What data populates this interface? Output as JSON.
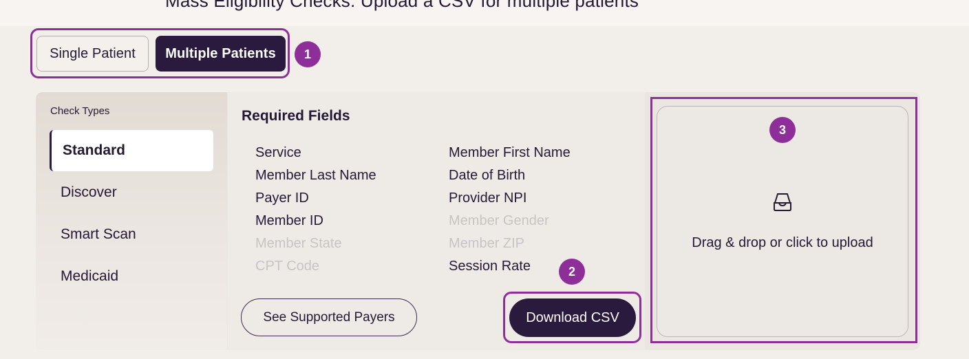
{
  "header": {
    "cut_text": "Mass Eligibility Checks: Upload a CSV for multiple patients"
  },
  "mode_toggle": {
    "single_label": "Single Patient",
    "multiple_label": "Multiple Patients",
    "selected": "Multiple Patients"
  },
  "badges": [
    "1",
    "2",
    "3"
  ],
  "sidebar": {
    "title": "Check Types",
    "items": [
      {
        "label": "Standard",
        "active": true
      },
      {
        "label": "Discover",
        "active": false
      },
      {
        "label": "Smart Scan",
        "active": false
      },
      {
        "label": "Medicaid",
        "active": false
      }
    ]
  },
  "required_fields": {
    "title": "Required Fields",
    "fields": [
      {
        "label": "Service",
        "required": true
      },
      {
        "label": "Member First Name",
        "required": true
      },
      {
        "label": "Member Last Name",
        "required": true
      },
      {
        "label": "Date of Birth",
        "required": true
      },
      {
        "label": "Payer ID",
        "required": true
      },
      {
        "label": "Provider NPI",
        "required": true
      },
      {
        "label": "Member ID",
        "required": true
      },
      {
        "label": "Member Gender",
        "required": false
      },
      {
        "label": "Member State",
        "required": false
      },
      {
        "label": "Member ZIP",
        "required": false
      },
      {
        "label": "CPT Code",
        "required": false
      },
      {
        "label": "Session Rate",
        "required": true
      }
    ]
  },
  "actions": {
    "payers_label": "See Supported Payers",
    "download_label": "Download CSV"
  },
  "upload": {
    "icon": "inbox-tray-icon",
    "label": "Drag & drop or click to upload"
  },
  "colors": {
    "accent": "#8e2f99",
    "dark": "#2a1a3e",
    "background": "#f2eeea",
    "muted_text": "#c8c3c6"
  }
}
